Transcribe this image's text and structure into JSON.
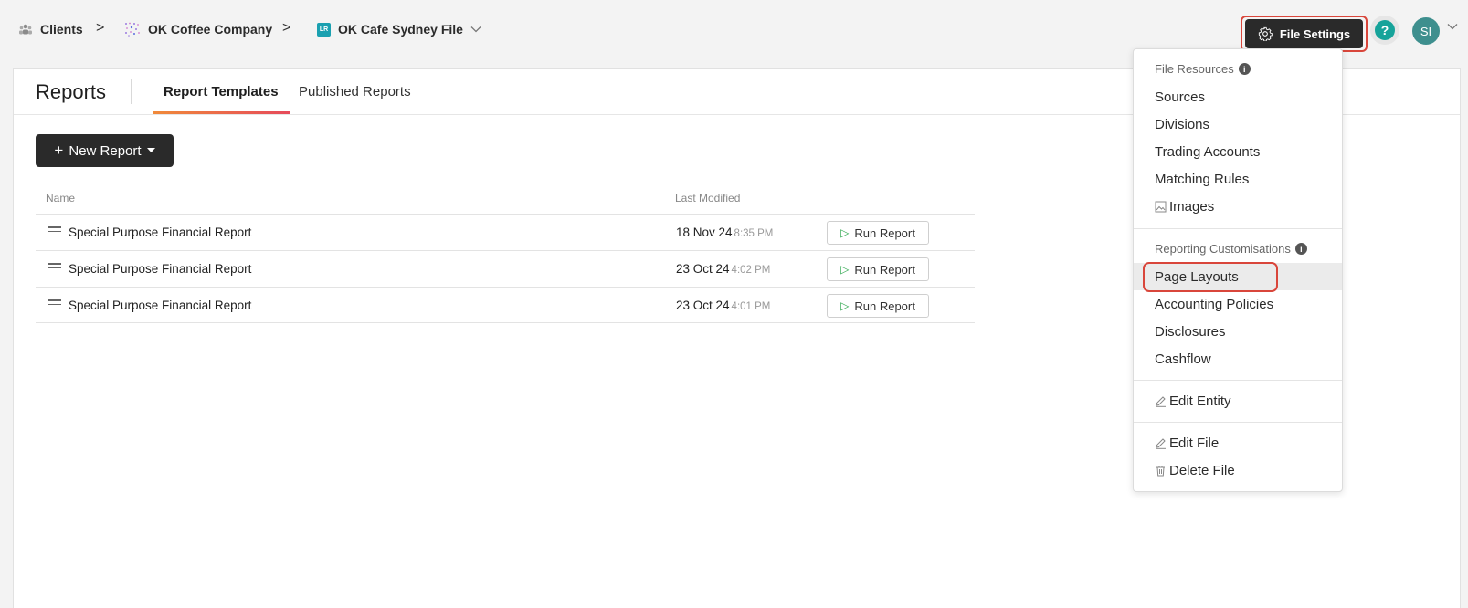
{
  "breadcrumb": {
    "clients_label": "Clients",
    "company_label": "OK Coffee Company",
    "file_label": "OK Cafe Sydney File",
    "file_badge": "LR",
    "separator": ">"
  },
  "header": {
    "file_settings_label": "File Settings",
    "help_glyph": "?",
    "avatar_initials": "SI"
  },
  "page": {
    "title": "Reports",
    "tabs": [
      {
        "label": "Report Templates",
        "active": true
      },
      {
        "label": "Published Reports",
        "active": false
      }
    ],
    "new_report_label": "New Report",
    "new_report_plus": "+",
    "columns": {
      "name": "Name",
      "last_modified": "Last Modified"
    },
    "rows": [
      {
        "name": "Special Purpose Financial Report",
        "date": "18 Nov 24",
        "time": "8:35 PM",
        "action": "Run Report"
      },
      {
        "name": "Special Purpose Financial Report",
        "date": "23 Oct 24",
        "time": "4:02 PM",
        "action": "Run Report"
      },
      {
        "name": "Special Purpose Financial Report",
        "date": "23 Oct 24",
        "time": "4:01 PM",
        "action": "Run Report"
      }
    ]
  },
  "dropdown": {
    "file_resources_heading": "File Resources",
    "file_resources": [
      "Sources",
      "Divisions",
      "Trading Accounts",
      "Matching Rules",
      "Images"
    ],
    "reporting_heading": "Reporting Customisations",
    "reporting": [
      "Page Layouts",
      "Accounting Policies",
      "Disclosures",
      "Cashflow"
    ],
    "edit_entity": "Edit Entity",
    "edit_file": "Edit File",
    "delete_file": "Delete File",
    "highlighted_item": "Page Layouts"
  },
  "colors": {
    "accent_red": "#d9463b",
    "dark_button": "#2a2a2a",
    "help_teal": "#16a39a",
    "avatar_teal": "#3e8f8e",
    "play_green": "#2fa84f"
  },
  "icons": [
    "clients-icon",
    "company-icon",
    "file-badge-icon",
    "gear-icon",
    "help-icon",
    "chevron-down-icon",
    "drag-handle-icon",
    "play-icon",
    "info-icon",
    "image-icon",
    "pencil-icon",
    "trash-icon"
  ]
}
